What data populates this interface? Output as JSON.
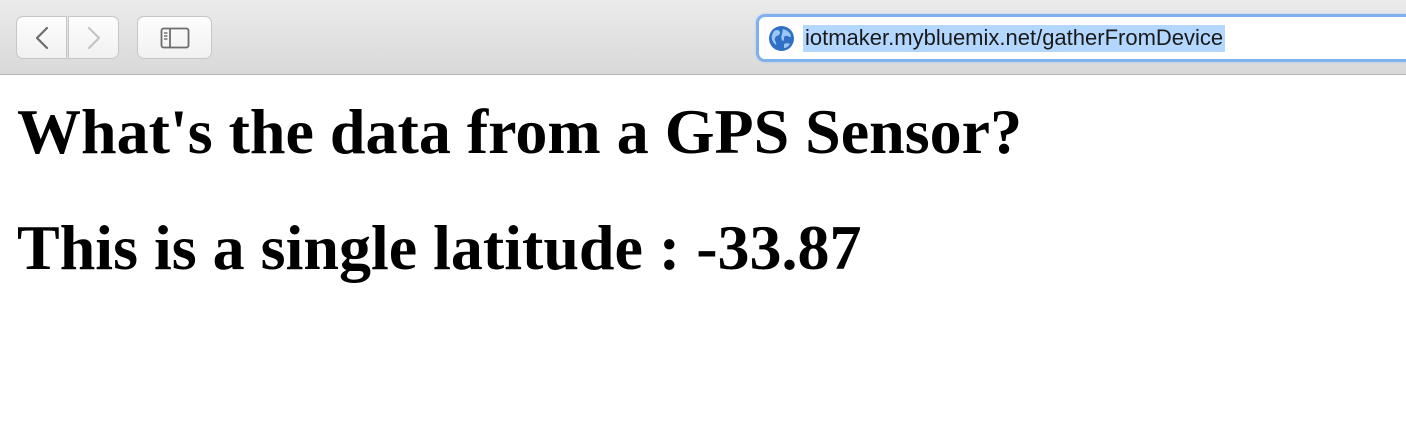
{
  "browser": {
    "url": "iotmaker.mybluemix.net/gatherFromDevice",
    "back_icon": "chevron-left-icon",
    "forward_icon": "chevron-right-icon",
    "sidebar_icon": "sidebar-icon",
    "site_icon": "globe-icon",
    "selection_color": "#b3d7ff",
    "focus_ring_color": "#7fb2ec"
  },
  "page": {
    "heading": "What's the data from a GPS Sensor?",
    "subheading": "This is a single latitude : -33.87"
  }
}
